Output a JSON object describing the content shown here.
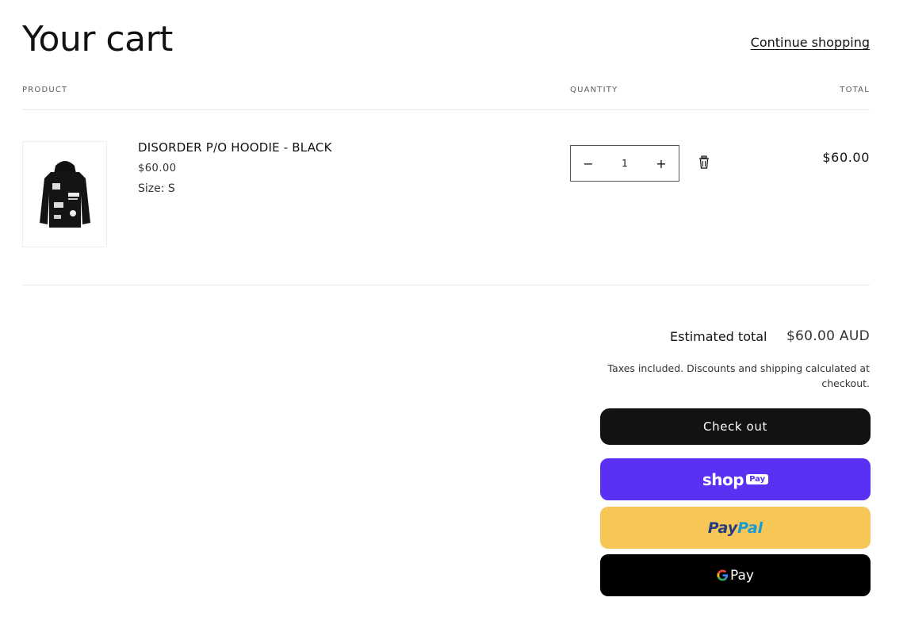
{
  "header": {
    "title": "Your cart",
    "continue_link": "Continue shopping"
  },
  "columns": {
    "product": "PRODUCT",
    "quantity": "QUANTITY",
    "total": "TOTAL"
  },
  "cart": {
    "items": [
      {
        "name": "DISORDER P/O HOODIE - BLACK",
        "price": "$60.00",
        "size": "Size: S",
        "quantity": "1",
        "line_total": "$60.00",
        "image_icon": "hoodie-image"
      }
    ]
  },
  "qty_controls": {
    "decrease": "−",
    "increase": "+"
  },
  "summary": {
    "estimated_label": "Estimated total",
    "estimated_value": "$60.00 AUD",
    "tax_note": "Taxes included. Discounts and shipping calculated at checkout."
  },
  "buttons": {
    "checkout": "Check out",
    "shop_word": "shop",
    "shop_badge": "Pay",
    "paypal_a": "Pay",
    "paypal_b": "Pal",
    "gpay_g": "G",
    "gpay_word": "Pay"
  },
  "colors": {
    "shop_pay": "#5a31f4",
    "paypal": "#f6c657",
    "gpay": "#000000",
    "checkout": "#121212"
  }
}
